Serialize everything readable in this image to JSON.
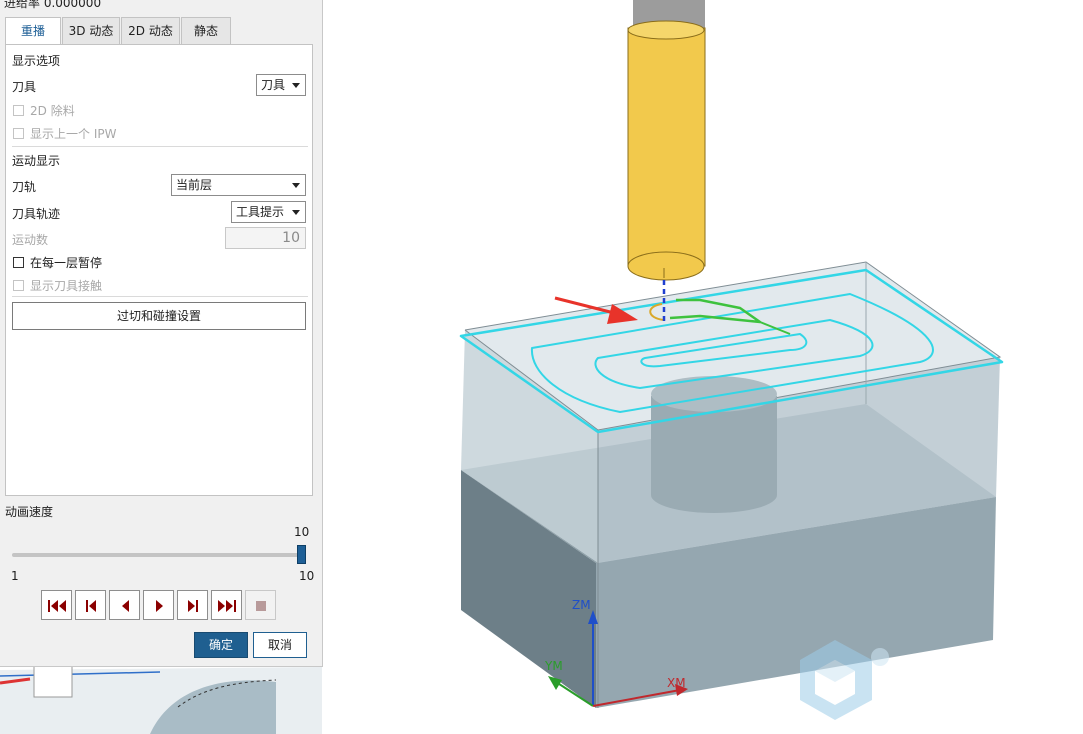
{
  "dialog": {
    "progress_text": "进给率 0.000000",
    "tabs": [
      {
        "label": "重播",
        "active": true
      },
      {
        "label": "3D 动态",
        "active": false
      },
      {
        "label": "2D 动态",
        "active": false
      },
      {
        "label": "静态",
        "active": false
      }
    ],
    "display_options": {
      "title": "显示选项",
      "tool_label": "刀具",
      "tool_value": "刀具",
      "remove_2d_label": "2D 除料",
      "remove_2d_checked": false,
      "show_prev_ipw_label": "显示上一个 IPW",
      "show_prev_ipw_checked": false
    },
    "motion_display": {
      "title": "运动显示",
      "toolpath_label": "刀轨",
      "toolpath_value": "当前层",
      "tool_trace_label": "刀具轨迹",
      "tool_trace_value": "工具提示",
      "motion_count_label": "运动数",
      "motion_count_value": "10",
      "pause_each_layer_label": "在每一层暂停",
      "pause_each_layer_checked": false,
      "show_tool_contact_label": "显示刀具接触",
      "show_tool_contact_checked": false
    },
    "overcut_button": "过切和碰撞设置",
    "speed": {
      "title": "动画速度",
      "value": 10,
      "value_label": "10",
      "min_label": "1",
      "max_label": "10"
    },
    "playback_buttons": [
      "rewind-to-start",
      "step-back",
      "play-reverse",
      "play-forward",
      "step-forward",
      "fast-forward-to-end",
      "stop"
    ],
    "ok_label": "确定",
    "cancel_label": "取消"
  },
  "viewport": {
    "axes": {
      "z": "ZM",
      "y": "YM",
      "x": "XM"
    },
    "colors": {
      "tool_body": "#f2c94c",
      "tool_holder": "#9a9a9a",
      "toolpath": "#33d6e6",
      "toolpath_active": "#3ec23e",
      "arrow": "#e8332a",
      "x_axis": "#c0282d",
      "y_axis": "#2a9d2a",
      "z_axis": "#1f4fc9"
    }
  }
}
